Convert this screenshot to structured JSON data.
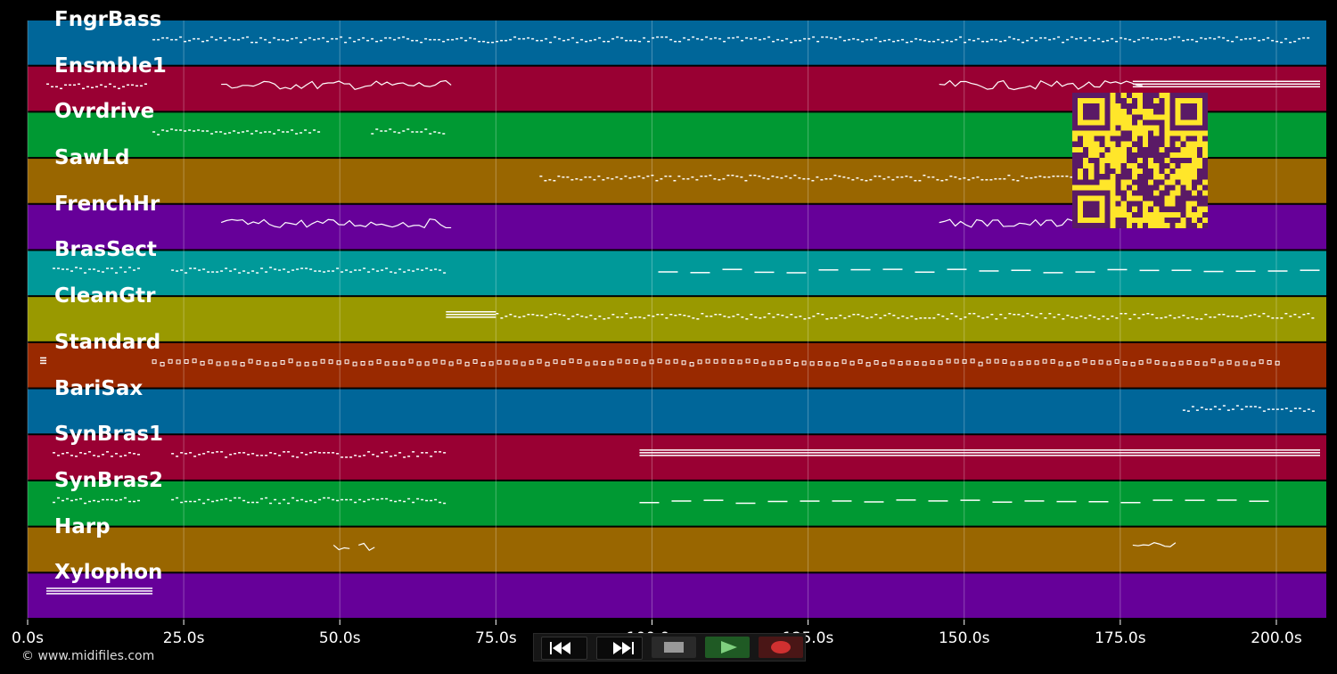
{
  "tracks": [
    {
      "name": "FngrBass",
      "color": "#006699"
    },
    {
      "name": "Ensmble1",
      "color": "#990033"
    },
    {
      "name": "Ovrdrive",
      "color": "#009933"
    },
    {
      "name": "SawLd",
      "color": "#996600"
    },
    {
      "name": "FrenchHr",
      "color": "#660099"
    },
    {
      "name": "BrasSect",
      "color": "#009999"
    },
    {
      "name": "CleanGtr",
      "color": "#999900"
    },
    {
      "name": "Standard",
      "color": "#992900"
    },
    {
      "name": "BariSax",
      "color": "#006699"
    },
    {
      "name": "SynBras1",
      "color": "#990033"
    },
    {
      "name": "SynBras2",
      "color": "#009933"
    },
    {
      "name": "Harp",
      "color": "#996600"
    },
    {
      "name": "Xylophon",
      "color": "#660099"
    }
  ],
  "timeline": {
    "unit": "s",
    "max_seconds": 208,
    "ticks": [
      "0.0s",
      "25.0s",
      "50.0s",
      "75.0s",
      "100.0s",
      "125.0s",
      "150.0s",
      "175.0s",
      "200.0s"
    ],
    "tick_values": [
      0,
      25,
      50,
      75,
      100,
      125,
      150,
      175,
      200
    ]
  },
  "notes": [
    {
      "track": 0,
      "from": 20,
      "to": 205,
      "style": "dash"
    },
    {
      "track": 1,
      "from": 3,
      "to": 19,
      "style": "dash"
    },
    {
      "track": 1,
      "from": 31,
      "to": 67,
      "style": "wave"
    },
    {
      "track": 1,
      "from": 146,
      "to": 178,
      "style": "wave"
    },
    {
      "track": 1,
      "from": 177,
      "to": 207,
      "style": "solid"
    },
    {
      "track": 2,
      "from": 20,
      "to": 47,
      "style": "dash"
    },
    {
      "track": 2,
      "from": 55,
      "to": 67,
      "style": "dash"
    },
    {
      "track": 3,
      "from": 82,
      "to": 170,
      "style": "dash"
    },
    {
      "track": 4,
      "from": 31,
      "to": 67,
      "style": "wave"
    },
    {
      "track": 4,
      "from": 146,
      "to": 176,
      "style": "wave"
    },
    {
      "track": 5,
      "from": 4,
      "to": 18,
      "style": "dash"
    },
    {
      "track": 5,
      "from": 23,
      "to": 67,
      "style": "dash"
    },
    {
      "track": 5,
      "from": 101,
      "to": 207,
      "style": "sparse"
    },
    {
      "track": 6,
      "from": 67,
      "to": 75,
      "style": "solid"
    },
    {
      "track": 6,
      "from": 75,
      "to": 206,
      "style": "dash"
    },
    {
      "track": 7,
      "from": 2,
      "to": 3,
      "style": "solid"
    },
    {
      "track": 7,
      "from": 20,
      "to": 201,
      "style": "dots"
    },
    {
      "track": 8,
      "from": 185,
      "to": 206,
      "style": "dash"
    },
    {
      "track": 9,
      "from": 4,
      "to": 18,
      "style": "dash"
    },
    {
      "track": 9,
      "from": 23,
      "to": 67,
      "style": "dash"
    },
    {
      "track": 9,
      "from": 98,
      "to": 207,
      "style": "solid"
    },
    {
      "track": 10,
      "from": 4,
      "to": 18,
      "style": "dash"
    },
    {
      "track": 10,
      "from": 23,
      "to": 67,
      "style": "dash"
    },
    {
      "track": 10,
      "from": 98,
      "to": 200,
      "style": "sparse"
    },
    {
      "track": 11,
      "from": 49,
      "to": 51,
      "style": "wave"
    },
    {
      "track": 11,
      "from": 53,
      "to": 55,
      "style": "wave"
    },
    {
      "track": 11,
      "from": 177,
      "to": 183,
      "style": "wave"
    },
    {
      "track": 12,
      "from": 3,
      "to": 20,
      "style": "solid"
    }
  ],
  "transport": {
    "rewind": {
      "icon": "rewind-icon"
    },
    "fast_forward": {
      "icon": "fast-forward-icon"
    },
    "stop": {
      "icon": "stop-icon",
      "color": "#888888"
    },
    "play": {
      "icon": "play-icon",
      "color": "#44aa44"
    },
    "record": {
      "icon": "record-icon",
      "color": "#cc2222"
    }
  },
  "qr_code": {
    "icon": "qr-code-icon",
    "color": "#ffe62a",
    "fg": "#5a1a66"
  },
  "credit": "© www.midifiles.com"
}
